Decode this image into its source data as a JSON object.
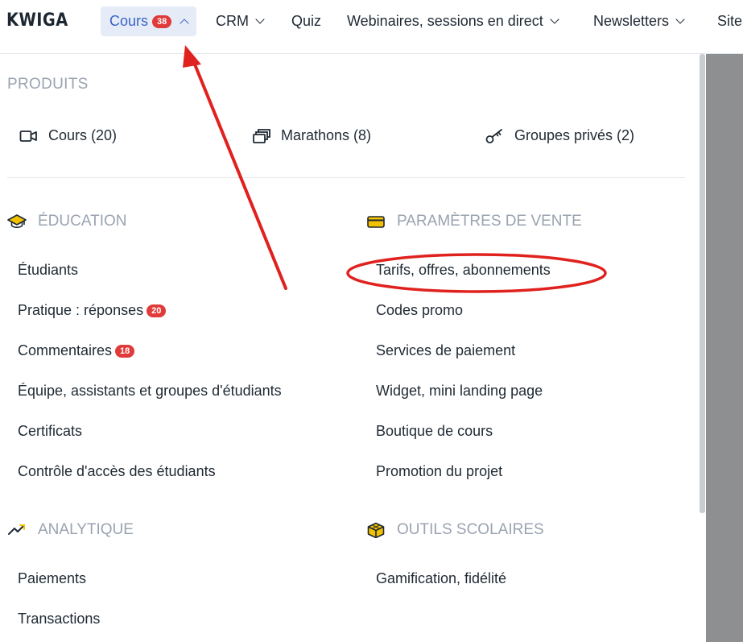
{
  "header": {
    "logo": "KWIGA",
    "nav": [
      {
        "label": "Cours",
        "badge": "38"
      },
      {
        "label": "CRM"
      },
      {
        "label": "Quiz"
      },
      {
        "label": "Webinaires, sessions en direct"
      },
      {
        "label": "Newsletters"
      },
      {
        "label": "Site"
      }
    ]
  },
  "menu": {
    "produits": {
      "title": "PRODUITS",
      "items": [
        "Cours (20)",
        "Marathons (8)",
        "Groupes privés (2)"
      ]
    },
    "education": {
      "title": "ÉDUCATION",
      "items": [
        {
          "label": "Étudiants"
        },
        {
          "label": "Pratique : réponses",
          "badge": "20"
        },
        {
          "label": "Commentaires",
          "badge": "18"
        },
        {
          "label": "Équipe, assistants et groupes d'étudiants"
        },
        {
          "label": "Certificats"
        },
        {
          "label": "Contrôle d'accès des étudiants"
        }
      ]
    },
    "vente": {
      "title": "PARAMÈTRES DE VENTE",
      "items": [
        "Tarifs, offres, abonnements",
        "Codes promo",
        "Services de paiement",
        "Widget, mini landing page",
        "Boutique de cours",
        "Promotion du projet"
      ]
    },
    "analytique": {
      "title": "ANALYTIQUE",
      "items": [
        "Paiements",
        "Transactions"
      ]
    },
    "outils": {
      "title": "OUTILS SCOLAIRES",
      "items": [
        "Gamification, fidélité"
      ]
    }
  },
  "colors": {
    "accent": "#3a62c8",
    "badge": "#e03a3a",
    "annotation": "#e0221f",
    "icon_yellow": "#f2c200"
  }
}
